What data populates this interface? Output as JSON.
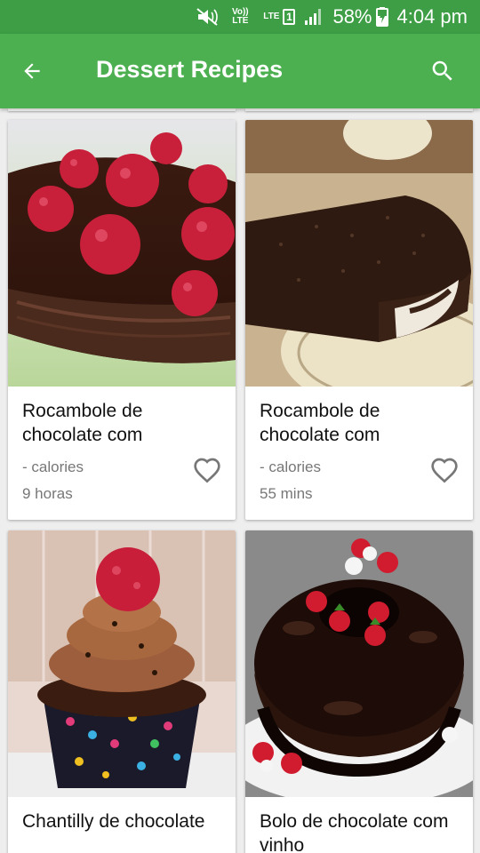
{
  "status_bar": {
    "volte": "Vo)) LTE",
    "lte": "LTE",
    "sim": "1",
    "battery_percent": "58%",
    "time": "4:04 pm"
  },
  "app_bar": {
    "title": "Dessert Recipes",
    "back_icon": "arrow-back-icon",
    "search_icon": "search-icon"
  },
  "recipes": [
    {
      "name": "Rocambole de chocolate com",
      "calories": "- calories",
      "time": "9 horas",
      "photo": "chocolate roll topped with raspberries",
      "favorite": false
    },
    {
      "name": "Rocambole de chocolate com",
      "calories": "- calories",
      "time": "55 mins",
      "photo": "chocolate swiss roll on plate",
      "favorite": false
    },
    {
      "name": "Chantilly de chocolate",
      "calories": "",
      "time": "",
      "photo": "chocolate cupcake with raspberry",
      "favorite": false
    },
    {
      "name": "Bolo de chocolate com vinho",
      "calories": "",
      "time": "",
      "photo": "chocolate bundt cake with strawberries",
      "favorite": false
    }
  ],
  "colors": {
    "status_bar": "#3d9e45",
    "app_bar": "#4caf50",
    "background": "#eeeeee",
    "card": "#ffffff",
    "secondary_text": "#777777"
  }
}
